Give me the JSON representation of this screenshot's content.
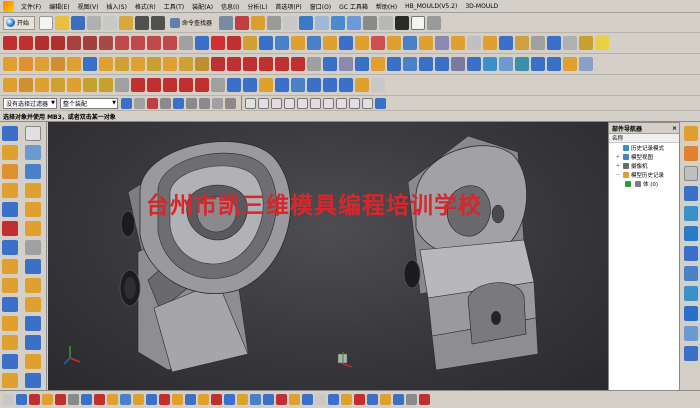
{
  "menu": {
    "items": [
      "文件(F)",
      "编辑(E)",
      "视图(V)",
      "插入(S)",
      "格式(R)",
      "工具(T)",
      "装配(A)",
      "信息(I)",
      "分析(L)",
      "首选项(P)",
      "窗口(O)",
      "GC 工具箱",
      "帮助(H)",
      "HB_MOULD(V5.2)",
      "3D-MOULD"
    ]
  },
  "toolbar": {
    "start_label": "开始",
    "command_finder_label": "命令查找器"
  },
  "selection": {
    "filter_value": "没有选择过滤器",
    "assembly_value": "整个装配"
  },
  "prompt": {
    "text": "选择对象并使用 MB3，或者双击某一对象"
  },
  "watermark": {
    "text": "台州市凯三维模具编程培训学校"
  },
  "navigator": {
    "title": "部件导航器",
    "close_glyph": "×",
    "column_header": "名称",
    "items": [
      {
        "label": "历史记录模式",
        "expander": ""
      },
      {
        "label": "模型视图",
        "expander": "+"
      },
      {
        "label": "摄像机",
        "expander": "+"
      },
      {
        "label": "模型历史记录",
        "expander": "−"
      },
      {
        "label": "体 (0)",
        "expander": ""
      }
    ]
  },
  "colors": {
    "accent_blue": "#1b6fd0",
    "watermark_red": "#d8262a",
    "viewport_bg": "#3a3a3e"
  }
}
